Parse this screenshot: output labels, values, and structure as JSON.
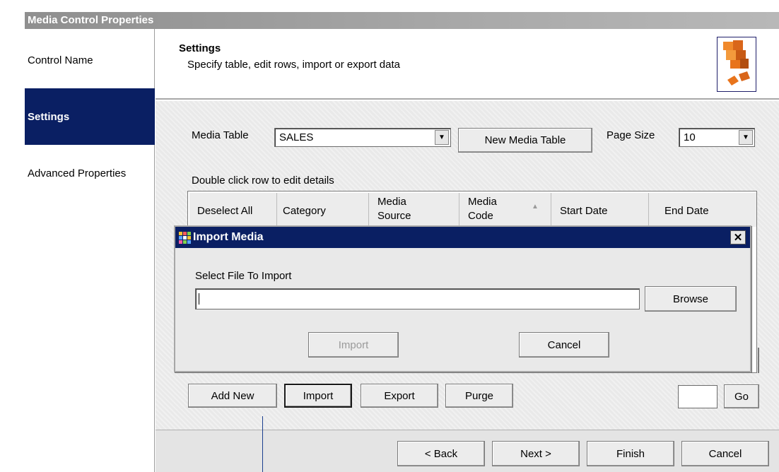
{
  "window": {
    "title": "Media Control Properties"
  },
  "sidebar": {
    "items": [
      {
        "label": "Control Name",
        "selected": false
      },
      {
        "label": "Settings",
        "selected": true
      },
      {
        "label": "Advanced Properties",
        "selected": false
      }
    ]
  },
  "header": {
    "title": "Settings",
    "subtitle": "Specify table, edit rows, import or export data",
    "logo_icon": "orange-cubes-icon"
  },
  "settings": {
    "media_table_label": "Media Table",
    "media_table_value": "SALES",
    "new_media_table_button": "New Media Table",
    "page_size_label": "Page Size",
    "page_size_value": "10",
    "grid_hint": "Double click row to edit details"
  },
  "grid": {
    "columns": [
      {
        "label": "Deselect All"
      },
      {
        "label": "Category"
      },
      {
        "line1": "Media",
        "line2": "Source"
      },
      {
        "line1": "Media",
        "line2": "Code",
        "sort_icon": "sort-ascending-icon"
      },
      {
        "label": "Start Date"
      },
      {
        "label": "End Date"
      }
    ]
  },
  "import_dialog": {
    "title": "Import Media",
    "icon": "app-grid-icon",
    "close_label": "✕",
    "select_file_label": "Select File To Import",
    "file_path_value": "",
    "browse_button": "Browse",
    "import_button": "Import",
    "cancel_button": "Cancel"
  },
  "actions": {
    "add_new": "Add New",
    "import": "Import",
    "export": "Export",
    "purge": "Purge",
    "page_number_value": "",
    "go": "Go"
  },
  "footer": {
    "back": "< Back",
    "next": "Next >",
    "finish": "Finish",
    "cancel": "Cancel"
  },
  "colors": {
    "selection_navy": "#0a1f63",
    "title_gray": "#9f9f9f",
    "logo_orange": "#e8741c"
  }
}
